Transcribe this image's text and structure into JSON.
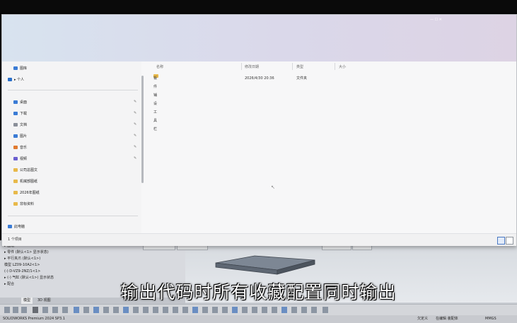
{
  "window_controls": "— ☐ ✕",
  "sidebar": {
    "personal": "▸ 个人",
    "gallery": "图库",
    "quick_access": [
      {
        "label": "桌面",
        "color": "#3a7bd5"
      },
      {
        "label": "下载",
        "color": "#3a7bd5"
      },
      {
        "label": "文档",
        "color": "#8a8f99"
      },
      {
        "label": "图片",
        "color": "#3a7bd5"
      },
      {
        "label": "音乐",
        "color": "#e07a30"
      },
      {
        "label": "视频",
        "color": "#6b5fd0"
      }
    ],
    "folders": [
      {
        "label": "公司总图文"
      },
      {
        "label": "机械部图纸"
      },
      {
        "label": "2026年图纸"
      },
      {
        "label": "非标资料"
      }
    ],
    "this_pc": "此电脑"
  },
  "columns": {
    "name": "名称",
    "date": "修改日期",
    "type": "类型",
    "size": "大小"
  },
  "file_rows": [
    {
      "name": "钣件铺设工具栏",
      "date": "2026/4/30 20:36",
      "type": "文件夹",
      "size": ""
    }
  ],
  "status": {
    "count": "1 个项目"
  },
  "cad": {
    "tree": [
      "▸ 图纸",
      "▸ 零件 (默认<1> 显示状态)",
      "▸ 平行夹爪 (默认<1>)",
      "  模型 LZ09-10A2<1>",
      "  (-) D-VZ9-2NZ/1<1>",
      "▸ (-) 气缸 (默认<1>) 显示状态",
      "▸ 配合"
    ],
    "tabs": [
      "模型",
      "3D 视图"
    ],
    "status_left": "SOLIDWORKS Premium 2024 SP3.1",
    "status_mid": "欠定义",
    "status_edit": "在编辑 装配体",
    "status_units": "MMGS"
  },
  "caption": "输出代码时所有收藏配置同时输出"
}
